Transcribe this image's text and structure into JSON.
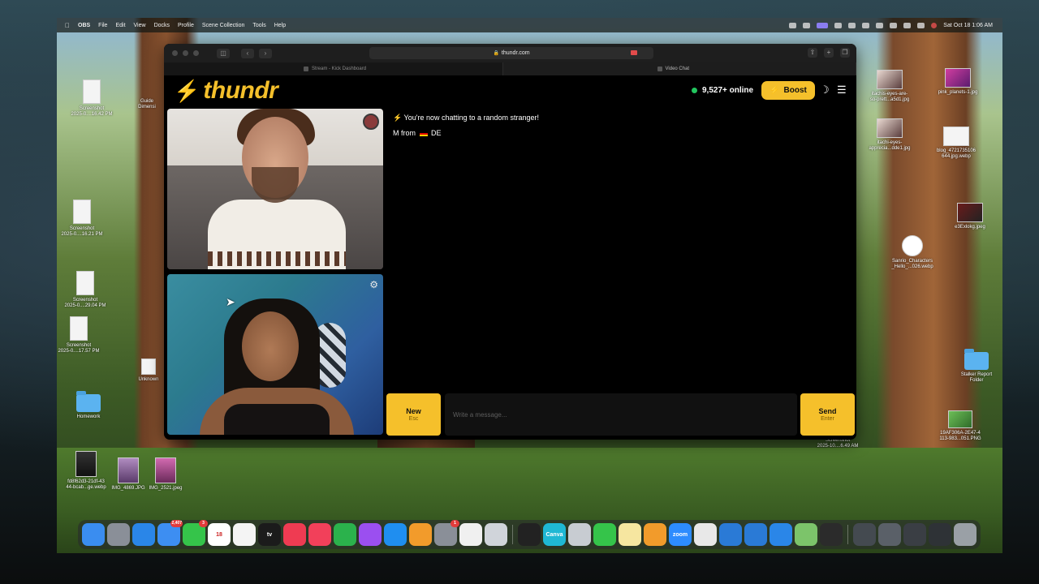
{
  "menubar": {
    "apple_icon": "apple-icon",
    "items": [
      "OBS",
      "File",
      "Edit",
      "View",
      "Docks",
      "Profile",
      "Scene Collection",
      "Tools",
      "Help"
    ],
    "clock": "Sat Oct 18  1:06 AM"
  },
  "desktop": {
    "icons_left": [
      {
        "label": "Screenshot\n2025-0....16.42 PM"
      },
      {
        "label": "Guide\nDimensi"
      },
      {
        "label": "Screenshot\n2025-0....16.21 PM"
      },
      {
        "label": "Screenshot\n2025-0....29.04 PM"
      },
      {
        "label": "Screenshot\n2025-0....17.57 PM"
      },
      {
        "label": "Unknown"
      },
      {
        "label": "Homework"
      },
      {
        "label": "fd8f62d3-21df-43\n44-bcab...ge.webp"
      },
      {
        "label": "IMG_4869.JPG"
      },
      {
        "label": "IMG_2521.jpeg"
      }
    ],
    "icons_right": [
      {
        "label": "itachis-eyes-are-\nso-prett...a5d1.jpg"
      },
      {
        "label": "pink_planets-1.jpg"
      },
      {
        "label": "itachi-eyes-\napprecia...dde1.jpg"
      },
      {
        "label": "blog_4721735106\n644.jpg.webp"
      },
      {
        "label": "e3Exlokg.jpeg"
      },
      {
        "label": "Sanrio_Characters\n_Hello_...026.webp"
      },
      {
        "label": "Stalker Report\nFolder"
      },
      {
        "label": "19AF306A-2E47-4\n113-983...051.PNG"
      },
      {
        "label": "Screenshot\n2025-10....6.49 AM"
      }
    ]
  },
  "browser": {
    "url": "thundr.com",
    "tabs": [
      {
        "label": "Stream - Kick Dashboard"
      },
      {
        "label": "Video Chat"
      }
    ]
  },
  "app": {
    "logo_text": "thundr",
    "online_count": "9,527+ online",
    "boost_label": "Boost",
    "chat": {
      "system_message": "⚡ You're now chatting to a random stranger!",
      "stranger_prefix": "M from",
      "stranger_country": "DE"
    },
    "composer": {
      "new_label": "New",
      "new_hint": "Esc",
      "placeholder": "Write a message...",
      "send_label": "Send",
      "send_hint": "Enter"
    },
    "accent_color": "#f5c02b",
    "online_dot_color": "#22c55e"
  },
  "dock": {
    "items": [
      {
        "name": "finder",
        "color": "#3a8df0"
      },
      {
        "name": "launchpad",
        "color": "#8a8f98"
      },
      {
        "name": "safari",
        "color": "#2a86e8"
      },
      {
        "name": "mail",
        "color": "#3d8ef2",
        "badge": "2,407"
      },
      {
        "name": "facetime",
        "color": "#35c44a",
        "badge": "3"
      },
      {
        "name": "calendar",
        "color": "#ffffff",
        "text": "18"
      },
      {
        "name": "reminders",
        "color": "#f4f4f4"
      },
      {
        "name": "apple-tv",
        "color": "#1b1b1b",
        "text": "tv"
      },
      {
        "name": "news",
        "color": "#ef3b52"
      },
      {
        "name": "music",
        "color": "#f2405a"
      },
      {
        "name": "numbers",
        "color": "#2bb24c"
      },
      {
        "name": "podcasts",
        "color": "#9b4ff0"
      },
      {
        "name": "keynote",
        "color": "#1f8ef0"
      },
      {
        "name": "pages",
        "color": "#f29b2b"
      },
      {
        "name": "system-settings",
        "color": "#8a8f98",
        "badge": "1"
      },
      {
        "name": "freeform",
        "color": "#f0f0f0"
      },
      {
        "name": "iphone-mirroring",
        "color": "#d0d4da"
      },
      {
        "name": "terminal",
        "color": "#222222"
      },
      {
        "name": "canva",
        "color": "#1fb8d4",
        "text": "Canva"
      },
      {
        "name": "disk-utility",
        "color": "#c8ccd2"
      },
      {
        "name": "messages",
        "color": "#35c44a"
      },
      {
        "name": "notes",
        "color": "#f6e6a0"
      },
      {
        "name": "books",
        "color": "#f29b2b"
      },
      {
        "name": "zoom",
        "color": "#2d8cff",
        "text": "zoom"
      },
      {
        "name": "chrome",
        "color": "#e8e8e8"
      },
      {
        "name": "vscode",
        "color": "#2a7ad6"
      },
      {
        "name": "bluetooth",
        "color": "#2a7ad6"
      },
      {
        "name": "app-store",
        "color": "#2a86e8"
      },
      {
        "name": "maps",
        "color": "#7cc46a"
      },
      {
        "name": "obs",
        "color": "#2b2b2b"
      },
      {
        "name": "recent-window-1",
        "color": "#444a50"
      },
      {
        "name": "recent-window-2",
        "color": "#5a6068"
      },
      {
        "name": "recent-window-3",
        "color": "#3a3e44"
      },
      {
        "name": "recent-window-4",
        "color": "#2e3236"
      },
      {
        "name": "trash",
        "color": "#9aa0a6"
      }
    ]
  }
}
